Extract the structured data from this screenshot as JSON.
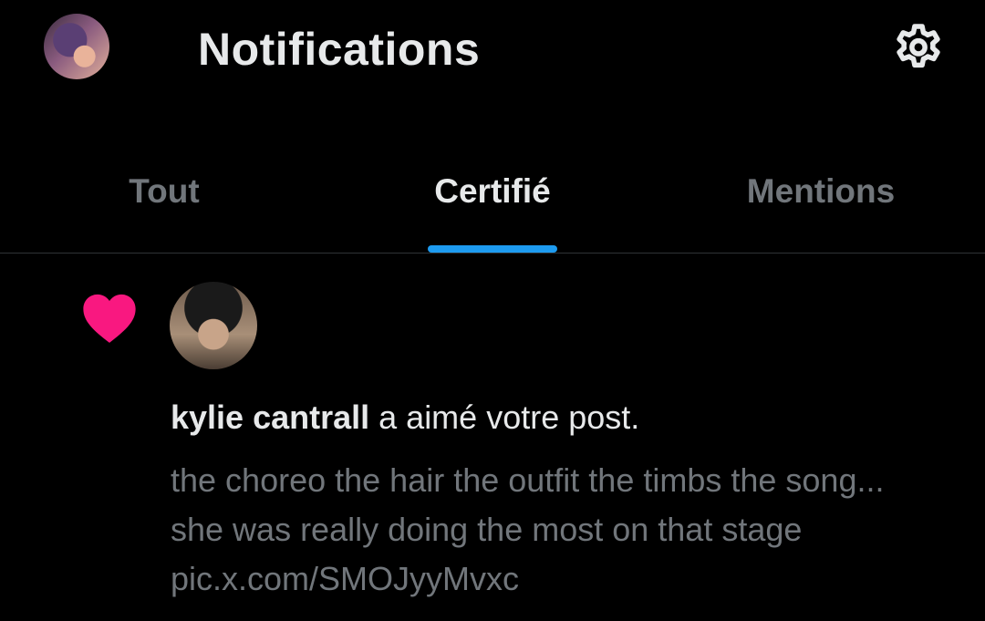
{
  "header": {
    "title": "Notifications",
    "avatar_icon": "user-avatar-icon",
    "settings_icon": "gear-icon"
  },
  "tabs": [
    {
      "label": "Tout",
      "active": false
    },
    {
      "label": "Certifié",
      "active": true
    },
    {
      "label": "Mentions",
      "active": false
    }
  ],
  "notification": {
    "type_icon": "heart-icon",
    "actor_name": "kylie cantrall",
    "action_text": " a aimé votre post.",
    "post_preview": "the choreo the hair the outfit the timbs the song... she was really doing the most on that stage pic.x.com/SMOJyyMvxc"
  },
  "colors": {
    "background": "#000000",
    "text_primary": "#e7e9ea",
    "text_secondary": "#71767b",
    "accent": "#1d9bf0",
    "like": "#f91880",
    "divider": "#2f3336"
  }
}
